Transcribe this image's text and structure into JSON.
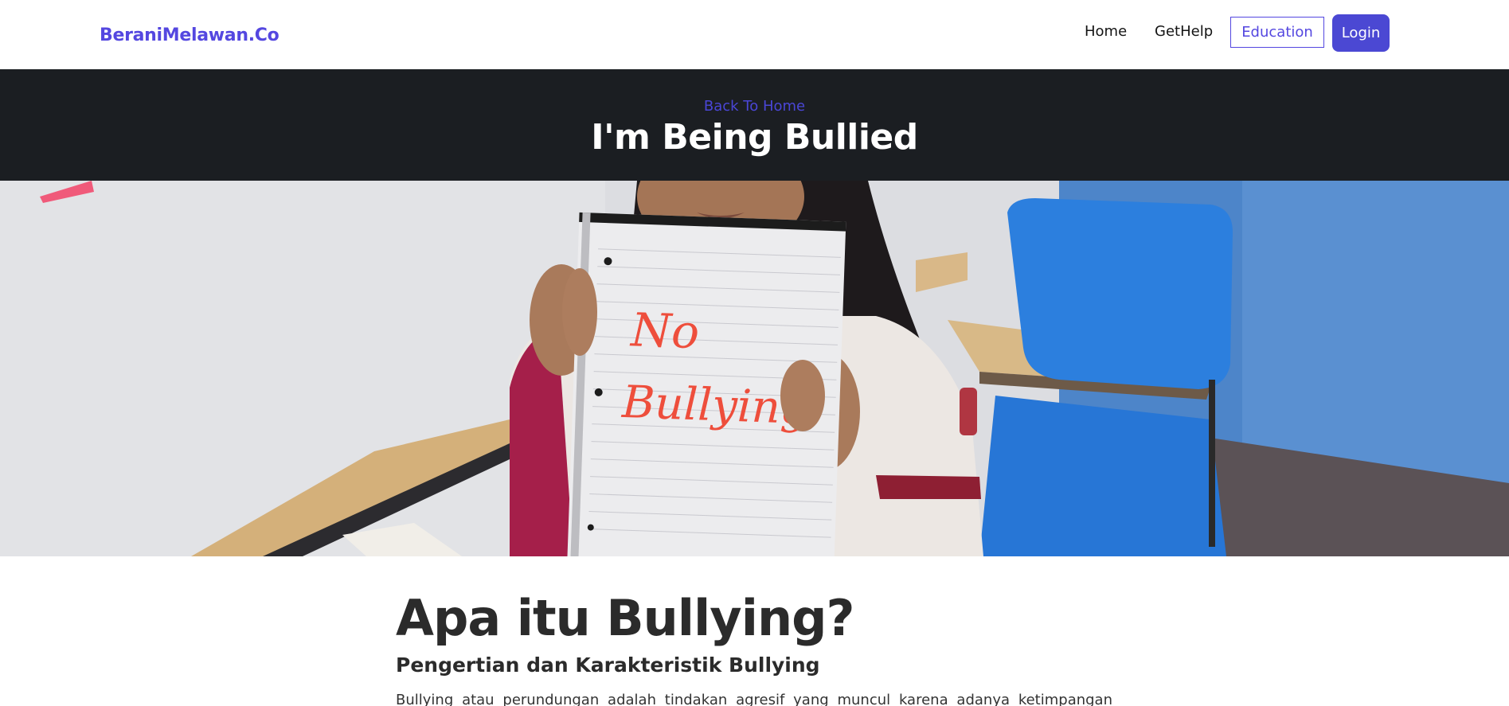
{
  "navbar": {
    "brand": "BeraniMelawan.Co",
    "links": {
      "home": "Home",
      "gethelp": "GetHelp",
      "education": "Education",
      "login": "Login"
    },
    "colors": {
      "brand": "#5447e0",
      "login_bg": "#4b48d3"
    }
  },
  "header": {
    "back_link": "Back To Home",
    "title": "I'm Being Bullied",
    "background": "#1b1e22"
  },
  "hero": {
    "notebook_text_line1": "No",
    "notebook_text_line2": "Bullying"
  },
  "article": {
    "title": "Apa itu Bullying?",
    "subtitle": "Pengertian dan Karakteristik Bullying",
    "body": "Bullying atau perundungan adalah tindakan agresif yang muncul karena adanya ketimpangan"
  }
}
